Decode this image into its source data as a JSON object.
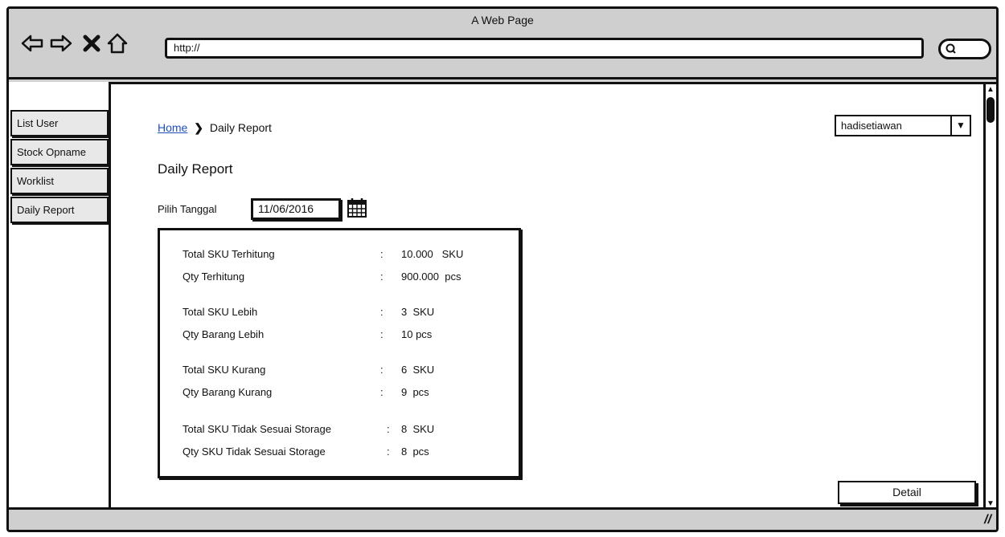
{
  "window": {
    "title": "A Web Page"
  },
  "toolbar": {
    "address_value": "http://",
    "icons": [
      "back-arrow-icon",
      "forward-arrow-icon",
      "close-icon",
      "home-icon",
      "search-icon"
    ]
  },
  "sidebar": {
    "items": [
      {
        "label": "List User"
      },
      {
        "label": "Stock Opname"
      },
      {
        "label": "Worklist"
      },
      {
        "label": "Daily Report"
      }
    ]
  },
  "breadcrumb": {
    "home": "Home",
    "current": "Daily Report"
  },
  "user_menu": {
    "selected": "hadisetiawan"
  },
  "page": {
    "title": "Daily Report",
    "date_label": "Pilih Tanggal",
    "date_value": "11/06/2016"
  },
  "report": {
    "rows": [
      {
        "label": "Total SKU Terhitung",
        "sep": ":",
        "value": "10.000   SKU"
      },
      {
        "label": "Qty Terhitung",
        "sep": ":",
        "value": "900.000  pcs"
      },
      {
        "label": "Total SKU Lebih",
        "sep": ":",
        "value": "3  SKU"
      },
      {
        "label": "Qty Barang Lebih",
        "sep": ":",
        "value": "10 pcs"
      },
      {
        "label": "Total SKU Kurang",
        "sep": ":",
        "value": "6  SKU"
      },
      {
        "label": "Qty Barang Kurang",
        "sep": ":",
        "value": "9  pcs"
      },
      {
        "label": "Total SKU Tidak Sesuai Storage",
        "sep": ":",
        "value": "8  SKU"
      },
      {
        "label": "Qty SKU Tidak Sesuai Storage",
        "sep": ":",
        "value": "8  pcs"
      }
    ]
  },
  "actions": {
    "detail_label": "Detail"
  }
}
